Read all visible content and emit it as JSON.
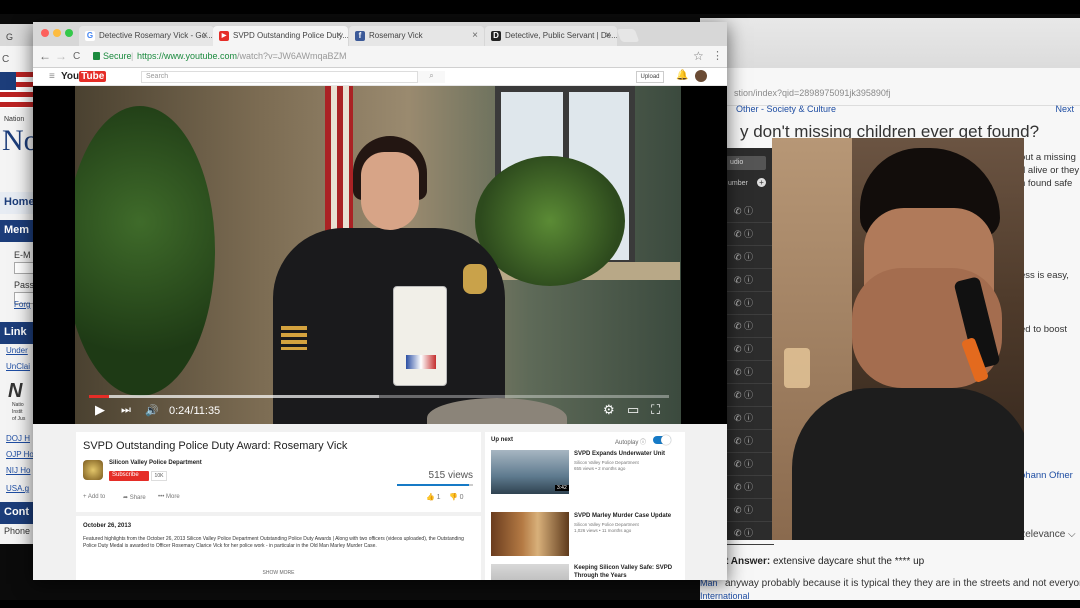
{
  "colors": {
    "accent_red": "#e52d27",
    "secure_green": "#1b8a3e",
    "link_blue": "#1f4ea3",
    "autoplay_blue": "#167ac6"
  },
  "back_left": {
    "tab_letter": "G",
    "reload_fragment": "C",
    "brand_fragment": "Nation",
    "brand_big": "No",
    "nav_home": "Home",
    "nav_mem": "Mem",
    "email_label": "E-M",
    "pass_label": "Pass",
    "forgot_link": "Forg",
    "links_header": "Link",
    "links": [
      "Under",
      "UnClai"
    ],
    "ni_logo": "N",
    "ni_sub": [
      "Natio",
      "Instit",
      "of Jus"
    ],
    "gov_links": [
      "DOJ H",
      "OJP Ho",
      "NIJ Ho",
      "USA.g"
    ],
    "contact_header": "Cont",
    "phone": "Phone"
  },
  "back_right": {
    "url": "stion/index?qid=2898975091jk395890fj",
    "crumb": "Other - Society & Culture",
    "next_top": "Next",
    "question": "y don't missing children ever get found?",
    "side_lines": [
      "out a missing",
      "d alive or they",
      "n found safe",
      "ess is easy,",
      "ed to boost",
      "ohann Ofner"
    ],
    "relevance": "Relevance",
    "answer_label": "t Answer:",
    "answer_text": "extensive daycare shut the **** up",
    "answer_body": "anyway probably because it is typical they they are in the streets and not everyone bother",
    "man_link": "Man",
    "intl_link": "International"
  },
  "contacts": {
    "audio_label": "udio",
    "number_label": "umber",
    "plus_icon": "+",
    "rows": 15,
    "row_icons": "✆ ⓘ"
  },
  "chrome": {
    "tabs": [
      {
        "label": "Detective Rosemary Vick - Go...",
        "favicon": "google-icon",
        "fav_text": "G",
        "fav_color": "#4285f4"
      },
      {
        "label": "SVPD Outstanding Police Duty...",
        "favicon": "youtube-icon",
        "fav_text": "▶",
        "fav_color": "#e52d27"
      },
      {
        "label": "Rosemary Vick",
        "favicon": "facebook-icon",
        "fav_text": "f",
        "fav_color": "#3b5998"
      },
      {
        "label": "Detective, Public Servant | De...",
        "favicon": "imdb-icon",
        "fav_text": "D",
        "fav_color": "#222222"
      }
    ],
    "tab_close": "×",
    "secure_label": "Secure",
    "url_host": "https://www.youtube.com",
    "url_path": "/watch?v=JW6AWmqaBZM",
    "back_icon": "←",
    "forward_icon": "→",
    "reload_icon": "C",
    "star_icon": "☆",
    "menu_icon": "⋮"
  },
  "youtube": {
    "logo_you": "You",
    "logo_tube": "Tube",
    "menu_icon": "≡",
    "search_placeholder": "Search",
    "search_icon": "⌕",
    "upload_label": "Upload",
    "bell_icon": "🔔"
  },
  "player": {
    "progress_fraction": 0.035,
    "loaded_fraction": 0.5,
    "time": "0:24/11:35",
    "play_icon": "▶",
    "next_icon": "⏭",
    "volume_icon": "🔊",
    "settings_icon": "⚙",
    "theater_icon": "▭",
    "fullscreen_icon": "⛶"
  },
  "video": {
    "title": "SVPD Outstanding Police Duty Award: Rosemary Vick",
    "channel": "Silicon Valley Police Department",
    "subscribe": "Subscribe",
    "subscribers": "10K",
    "views": "515 views",
    "add_to": "Add to",
    "share": "Share",
    "more": "More",
    "likes": "1",
    "dislikes": "0",
    "plus_icon": "+",
    "share_icon": "➦",
    "more_icon": "•••",
    "like_icon": "👍",
    "dislike_icon": "👎",
    "date": "October 26, 2013",
    "description": "Featured highlights from the October 26, 2013 Silicon Valley Police Department Outstanding Police Duty Awards | Along with two officers (videos uploaded), the Outstanding Police Duty Medal is awarded to Officer Rosemary Clarice Vick for her police work - in particular in the Old Man Marley Murder Case.",
    "show_more": "SHOW MORE"
  },
  "up_next": {
    "label": "Up next",
    "autoplay": "Autoplay",
    "info_icon": "ⓘ",
    "items": [
      {
        "title": "SVPD Expands Underwater Unit",
        "channel": "Silicon Valley Police Department",
        "meta": "655 views • 2 months ago",
        "duration": "3:42",
        "thumb": "linear-gradient(180deg,#a7b6c2,#5e7a8e 60%,#2f4250)"
      },
      {
        "title": "SVPD Marley Murder Case Update",
        "channel": "Silicon Valley Police Department",
        "meta": "1,026 views • 11 months ago",
        "duration": "",
        "thumb": "linear-gradient(90deg,#6a3c1e,#b47a44 40%,#d8b07a 60%,#5e3a1c)"
      },
      {
        "title": "Keeping Silicon Valley Safe: SVPD Through the Years",
        "channel": "",
        "meta": "",
        "duration": "",
        "thumb": "linear-gradient(180deg,#d8d8d8,#9a9a9a)"
      }
    ]
  }
}
